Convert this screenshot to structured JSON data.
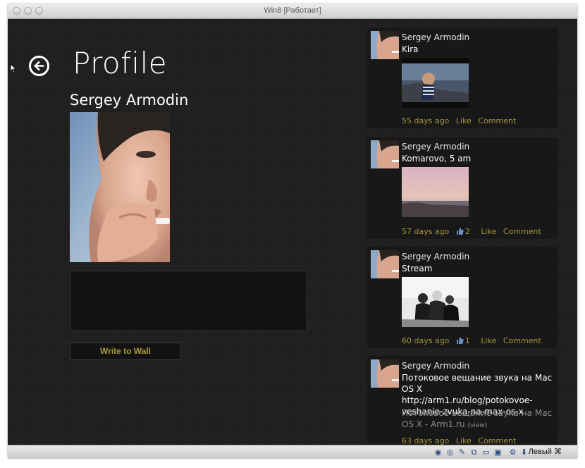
{
  "window": {
    "title": "Win8 [Работает]"
  },
  "page": {
    "title": "Profile",
    "profile_name": "Sergey Armodin",
    "write_button": "Write to Wall"
  },
  "status_bar": {
    "host_key": "Левый ⌘"
  },
  "posts": [
    {
      "author": "Sergey Armodin",
      "text": "Kira",
      "age": "55 days ago",
      "likes": "",
      "like_label": "Like",
      "comment_label": "Comment"
    },
    {
      "author": "Sergey Armodin",
      "text": "Komarovo, 5 am",
      "age": "57 days ago",
      "likes": "2",
      "like_label": "Like",
      "comment_label": "Comment"
    },
    {
      "author": "Sergey Armodin",
      "text": "Stream",
      "age": "60 days ago",
      "likes": "1",
      "like_label": "Like",
      "comment_label": "Comment"
    },
    {
      "author": "Sergey Armodin",
      "text": "Потоковое вещание звука на Mac OS X http://arm1.ru/blog/potokovoe-veshanie-zvuka-na-max-os-x",
      "link_title": "Потоковое вещание звука на Mac OS X - Arm1.ru",
      "link_view": "(view)",
      "age": "63 days ago",
      "likes": "",
      "like_label": "Like",
      "comment_label": "Comment"
    }
  ],
  "colors": {
    "background": "#1d1d1d",
    "accent": "#a3953a",
    "text": "#ffffff"
  },
  "icons": [
    "back-arrow-icon",
    "like-thumb-icon",
    "disk-icon",
    "cd-icon",
    "pen-icon",
    "network-icon",
    "folder-icon",
    "display-icon",
    "usb-icon",
    "mouse-capture-icon"
  ]
}
